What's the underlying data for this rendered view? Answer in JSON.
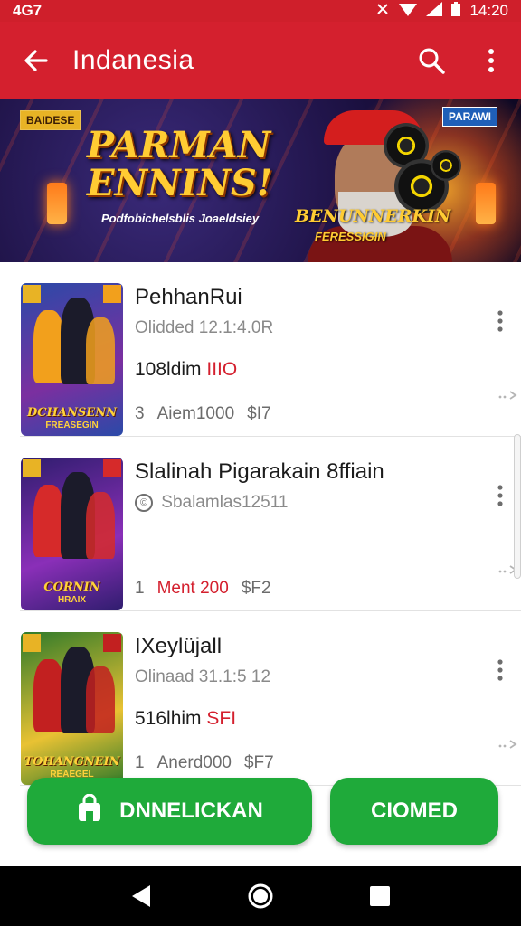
{
  "status_bar": {
    "left": "4G7",
    "time": "14:20"
  },
  "app_bar": {
    "title": "Indanesia"
  },
  "banner": {
    "tag_left": "BAIDESE",
    "tag_right": "PARAWI",
    "headline_line1": "PARMAN",
    "headline_line2": "ENNINS!",
    "subline": "Podfobichelsblis Joaeldsiey",
    "promo_title": "BENUNNERKIN",
    "promo_sub": "FERESSIGIN"
  },
  "items": [
    {
      "name": "PehhanRui",
      "meta": "Olidded 12.1:4.0R",
      "price_main": "108ldim",
      "price_accent": "IIIO",
      "stat_1": "3",
      "stat_2": "Aiem1000",
      "stat_3": "$I7",
      "thumb_title": "DCHANSENN",
      "thumb_sub": "FREASEGIN",
      "stat_2_red": false,
      "meta_icon": false,
      "palette": [
        "#2a4aa8",
        "#f2a01c",
        "#7b2fa0"
      ]
    },
    {
      "name": "Slalinah Pigarakain 8ffiain",
      "meta": "Sbalamlas12511",
      "price_main": "",
      "price_accent": "",
      "stat_1": "1",
      "stat_2": "Ment 200",
      "stat_3": "$F2",
      "thumb_title": "CORNIN",
      "thumb_sub": "HRAIX",
      "stat_2_red": true,
      "meta_icon": true,
      "palette": [
        "#2f1d6e",
        "#d62a2a",
        "#8a2fb8"
      ]
    },
    {
      "name": "IXeylüjall",
      "meta": "Olinaad 31.1:5 12",
      "price_main": "516lhim",
      "price_accent": "SFI",
      "stat_1": "1",
      "stat_2": "Anerd000",
      "stat_3": "$F7",
      "thumb_title": "TOHANGNEIN",
      "thumb_sub": "REAEGEL",
      "stat_2_red": false,
      "meta_icon": false,
      "palette": [
        "#2f7a2a",
        "#c22020",
        "#e9c233"
      ]
    }
  ],
  "buttons": {
    "primary": "DNNELICKAN",
    "secondary": "CIOMED"
  },
  "icons": {
    "back": "arrow-left-icon",
    "search": "search-icon",
    "more": "more-vert-icon",
    "nav_back": "nav-back-icon",
    "nav_home": "nav-home-icon",
    "nav_recents": "nav-recents-icon"
  },
  "colors": {
    "app_bar": "#d4202e",
    "accent": "#d4202e",
    "primary_button": "#1faa3a"
  }
}
